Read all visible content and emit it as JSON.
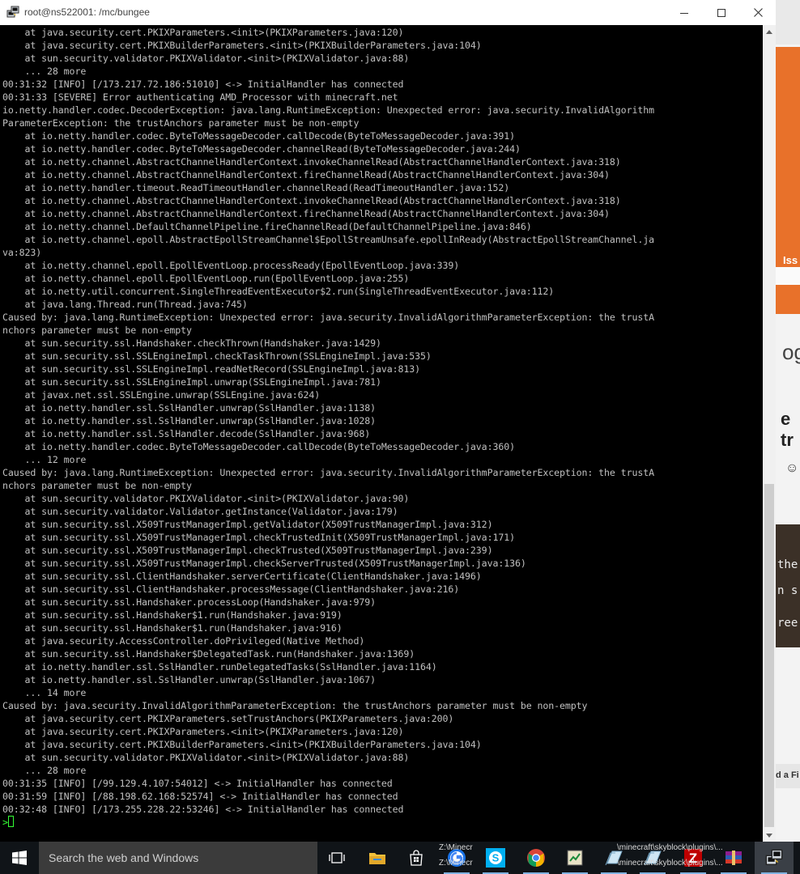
{
  "window": {
    "title": "root@ns522001: /mc/bungee"
  },
  "terminal": {
    "lines": [
      "    at java.security.cert.PKIXParameters.<init>(PKIXParameters.java:120)",
      "    at java.security.cert.PKIXBuilderParameters.<init>(PKIXBuilderParameters.java:104)",
      "    at sun.security.validator.PKIXValidator.<init>(PKIXValidator.java:88)",
      "    ... 28 more",
      "00:31:32 [INFO] [/173.217.72.186:51010] <-> InitialHandler has connected",
      "00:31:33 [SEVERE] Error authenticating AMD_Processor with minecraft.net",
      "io.netty.handler.codec.DecoderException: java.lang.RuntimeException: Unexpected error: java.security.InvalidAlgorithm",
      "ParameterException: the trustAnchors parameter must be non-empty",
      "    at io.netty.handler.codec.ByteToMessageDecoder.callDecode(ByteToMessageDecoder.java:391)",
      "    at io.netty.handler.codec.ByteToMessageDecoder.channelRead(ByteToMessageDecoder.java:244)",
      "    at io.netty.channel.AbstractChannelHandlerContext.invokeChannelRead(AbstractChannelHandlerContext.java:318)",
      "    at io.netty.channel.AbstractChannelHandlerContext.fireChannelRead(AbstractChannelHandlerContext.java:304)",
      "    at io.netty.handler.timeout.ReadTimeoutHandler.channelRead(ReadTimeoutHandler.java:152)",
      "    at io.netty.channel.AbstractChannelHandlerContext.invokeChannelRead(AbstractChannelHandlerContext.java:318)",
      "    at io.netty.channel.AbstractChannelHandlerContext.fireChannelRead(AbstractChannelHandlerContext.java:304)",
      "    at io.netty.channel.DefaultChannelPipeline.fireChannelRead(DefaultChannelPipeline.java:846)",
      "    at io.netty.channel.epoll.AbstractEpollStreamChannel$EpollStreamUnsafe.epollInReady(AbstractEpollStreamChannel.ja",
      "va:823)",
      "    at io.netty.channel.epoll.EpollEventLoop.processReady(EpollEventLoop.java:339)",
      "    at io.netty.channel.epoll.EpollEventLoop.run(EpollEventLoop.java:255)",
      "    at io.netty.util.concurrent.SingleThreadEventExecutor$2.run(SingleThreadEventExecutor.java:112)",
      "    at java.lang.Thread.run(Thread.java:745)",
      "Caused by: java.lang.RuntimeException: Unexpected error: java.security.InvalidAlgorithmParameterException: the trustA",
      "nchors parameter must be non-empty",
      "    at sun.security.ssl.Handshaker.checkThrown(Handshaker.java:1429)",
      "    at sun.security.ssl.SSLEngineImpl.checkTaskThrown(SSLEngineImpl.java:535)",
      "    at sun.security.ssl.SSLEngineImpl.readNetRecord(SSLEngineImpl.java:813)",
      "    at sun.security.ssl.SSLEngineImpl.unwrap(SSLEngineImpl.java:781)",
      "    at javax.net.ssl.SSLEngine.unwrap(SSLEngine.java:624)",
      "    at io.netty.handler.ssl.SslHandler.unwrap(SslHandler.java:1138)",
      "    at io.netty.handler.ssl.SslHandler.unwrap(SslHandler.java:1028)",
      "    at io.netty.handler.ssl.SslHandler.decode(SslHandler.java:968)",
      "    at io.netty.handler.codec.ByteToMessageDecoder.callDecode(ByteToMessageDecoder.java:360)",
      "    ... 12 more",
      "Caused by: java.lang.RuntimeException: Unexpected error: java.security.InvalidAlgorithmParameterException: the trustA",
      "nchors parameter must be non-empty",
      "    at sun.security.validator.PKIXValidator.<init>(PKIXValidator.java:90)",
      "    at sun.security.validator.Validator.getInstance(Validator.java:179)",
      "    at sun.security.ssl.X509TrustManagerImpl.getValidator(X509TrustManagerImpl.java:312)",
      "    at sun.security.ssl.X509TrustManagerImpl.checkTrustedInit(X509TrustManagerImpl.java:171)",
      "    at sun.security.ssl.X509TrustManagerImpl.checkTrusted(X509TrustManagerImpl.java:239)",
      "    at sun.security.ssl.X509TrustManagerImpl.checkServerTrusted(X509TrustManagerImpl.java:136)",
      "    at sun.security.ssl.ClientHandshaker.serverCertificate(ClientHandshaker.java:1496)",
      "    at sun.security.ssl.ClientHandshaker.processMessage(ClientHandshaker.java:216)",
      "    at sun.security.ssl.Handshaker.processLoop(Handshaker.java:979)",
      "    at sun.security.ssl.Handshaker$1.run(Handshaker.java:919)",
      "    at sun.security.ssl.Handshaker$1.run(Handshaker.java:916)",
      "    at java.security.AccessController.doPrivileged(Native Method)",
      "    at sun.security.ssl.Handshaker$DelegatedTask.run(Handshaker.java:1369)",
      "    at io.netty.handler.ssl.SslHandler.runDelegatedTasks(SslHandler.java:1164)",
      "    at io.netty.handler.ssl.SslHandler.unwrap(SslHandler.java:1067)",
      "    ... 14 more",
      "Caused by: java.security.InvalidAlgorithmParameterException: the trustAnchors parameter must be non-empty",
      "    at java.security.cert.PKIXParameters.setTrustAnchors(PKIXParameters.java:200)",
      "    at java.security.cert.PKIXParameters.<init>(PKIXParameters.java:120)",
      "    at java.security.cert.PKIXBuilderParameters.<init>(PKIXBuilderParameters.java:104)",
      "    at sun.security.validator.PKIXValidator.<init>(PKIXValidator.java:88)",
      "    ... 28 more",
      "00:31:35 [INFO] [/99.129.4.107:54012] <-> InitialHandler has connected",
      "00:31:59 [INFO] [/88.198.62.168:52574] <-> InitialHandler has connected",
      "00:32:48 [INFO] [/173.255.228.22:53246] <-> InitialHandler has connected"
    ],
    "prompt": ">",
    "colors": {
      "text": "#c0c0c0",
      "background": "#000000",
      "cursor": "#33ff33"
    }
  },
  "background_window": {
    "fragments": [
      "Iss",
      "ogi",
      "e tr",
      "☺",
      "the",
      "n s",
      "ree",
      "d a Fi"
    ],
    "accent": "#e8712a"
  },
  "taskbar": {
    "search_placeholder": "Search the web and Windows",
    "icons": [
      "windows-start-icon",
      "task-view-icon",
      "file-explorer-icon",
      "store-icon",
      "chrome-logo-icon",
      "skype-icon",
      "chrome-icon",
      "notepad-icon",
      "bookmark-icon",
      "bookmark-icon",
      "filezilla-icon",
      "winrar-icon",
      "putty-icon"
    ],
    "previews": [
      "Z:\\Minecr",
      "Z:\\Minecr",
      "\\minecraft\\skyblock\\plugins\\...",
      "\\minecraft\\skyblock\\plugins\\..."
    ]
  }
}
